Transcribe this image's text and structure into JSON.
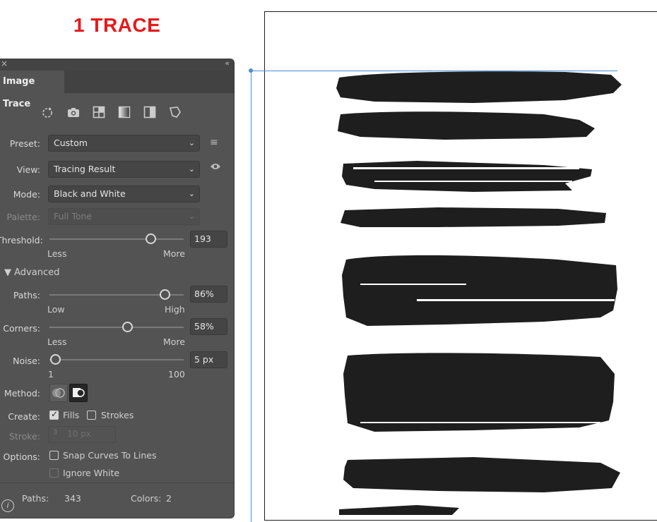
{
  "heading": "1 TRACE",
  "panel": {
    "tab_title": "Image Trace",
    "close_glyph": "×",
    "collapse_glyph": "«",
    "menu_glyph": "≡",
    "preset_icons": [
      "auto-color-icon",
      "high-color-icon",
      "low-color-icon",
      "grayscale-icon",
      "black-and-white-icon",
      "outline-icon"
    ],
    "preset": {
      "label": "Preset:",
      "value": "Custom"
    },
    "view": {
      "label": "View:",
      "value": "Tracing Result"
    },
    "mode": {
      "label": "Mode:",
      "value": "Black and White"
    },
    "palette": {
      "label": "Palette:",
      "value": "Full Tone"
    },
    "threshold": {
      "label": "Threshold:",
      "value": "193",
      "level": 0.75,
      "min_label": "Less",
      "max_label": "More"
    },
    "advanced": {
      "label": "Advanced"
    },
    "paths": {
      "label": "Paths:",
      "value": "86%",
      "level": 0.86,
      "min_label": "Low",
      "max_label": "High"
    },
    "corners": {
      "label": "Corners:",
      "value": "58%",
      "level": 0.58,
      "min_label": "Less",
      "max_label": "More"
    },
    "noise": {
      "label": "Noise:",
      "value": "5 px",
      "level": 0.04,
      "min_label": "1",
      "max_label": "100"
    },
    "method": {
      "label": "Method:",
      "selected": "overlapping"
    },
    "create": {
      "label": "Create:",
      "fills_label": "Fills",
      "fills_checked": true,
      "strokes_label": "Strokes",
      "strokes_checked": false
    },
    "stroke": {
      "label": "Stroke:",
      "value": "10 px"
    },
    "options": {
      "label": "Options:",
      "snap_label": "Snap Curves To Lines",
      "snap_checked": false,
      "ignore_white_label": "Ignore White",
      "ignore_white_checked": false
    },
    "stats": {
      "paths_label": "Paths:",
      "paths_value": "343",
      "colors_label": "Colors:",
      "colors_value": "2"
    },
    "info_glyph": "i"
  },
  "colors": {
    "heading_red": "#e5191c",
    "panel_bg": "#535353",
    "guide_blue": "#4a8cd6",
    "ink": "#1e1e1e"
  }
}
